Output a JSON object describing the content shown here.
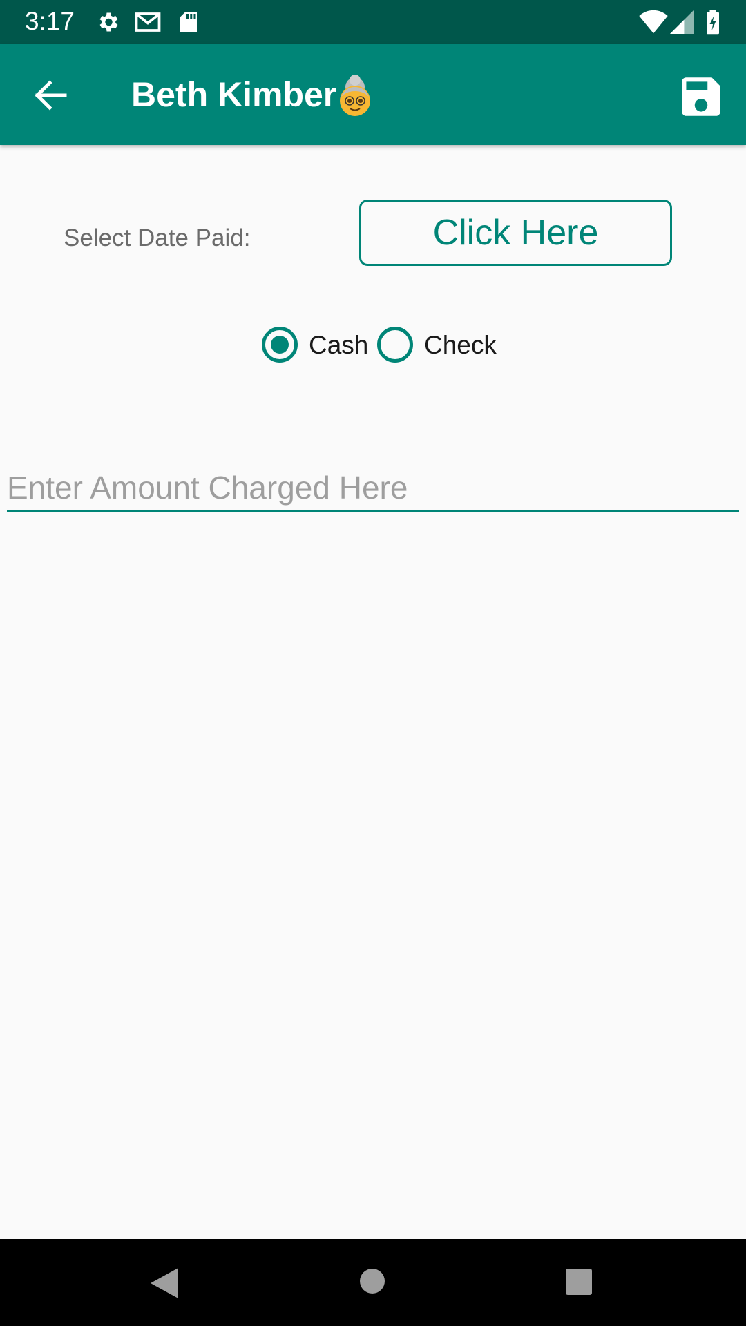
{
  "status_bar": {
    "time": "3:17",
    "icons": [
      "gear-icon",
      "gmail-icon",
      "sd-card-icon",
      "wifi-icon",
      "cell-signal-icon",
      "battery-charging-icon"
    ]
  },
  "app_bar": {
    "title": "Beth Kimber",
    "title_icon": "older-woman-emoji",
    "back_icon": "arrow-back-icon",
    "save_icon": "save-floppy-icon"
  },
  "form": {
    "date_label": "Select Date Paid:",
    "date_button": "Click Here",
    "payment_options": [
      {
        "label": "Cash",
        "selected": true
      },
      {
        "label": "Check",
        "selected": false
      }
    ],
    "amount": {
      "value": "",
      "placeholder": "Enter Amount Charged Here"
    }
  },
  "nav_bar": {
    "icons": [
      "back-triangle-icon",
      "home-circle-icon",
      "recents-square-icon"
    ]
  },
  "colors": {
    "primary": "#008577",
    "primary_dark": "#00574b",
    "background": "#fafafa"
  }
}
